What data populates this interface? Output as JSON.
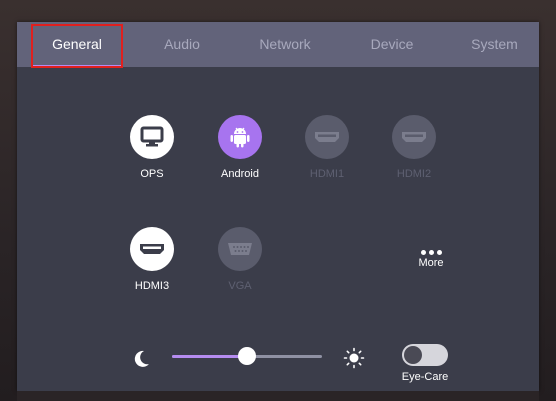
{
  "tabs": [
    {
      "label": "General",
      "active": true
    },
    {
      "label": "Audio",
      "active": false
    },
    {
      "label": "Network",
      "active": false
    },
    {
      "label": "Device",
      "active": false
    },
    {
      "label": "System",
      "active": false
    }
  ],
  "sources": [
    {
      "label": "OPS",
      "icon": "monitor-icon",
      "state": "available"
    },
    {
      "label": "Android",
      "icon": "android-icon",
      "state": "selected"
    },
    {
      "label": "HDMI1",
      "icon": "hdmi-icon",
      "state": "disabled"
    },
    {
      "label": "HDMI2",
      "icon": "hdmi-icon",
      "state": "disabled"
    },
    {
      "label": "HDMI3",
      "icon": "hdmi-icon",
      "state": "available"
    },
    {
      "label": "VGA",
      "icon": "vga-icon",
      "state": "disabled"
    }
  ],
  "more": {
    "label": "More",
    "icon": "more-dots-icon"
  },
  "brightness": {
    "value": 0.5,
    "min_icon": "moon-icon",
    "max_icon": "sun-icon"
  },
  "eye_care": {
    "label": "Eye-Care",
    "on": false
  },
  "colors": {
    "accent": "#a774ef",
    "tab_bar": "#62637a",
    "panel": "#3b3d4a",
    "highlight_box": "#e0201e"
  }
}
